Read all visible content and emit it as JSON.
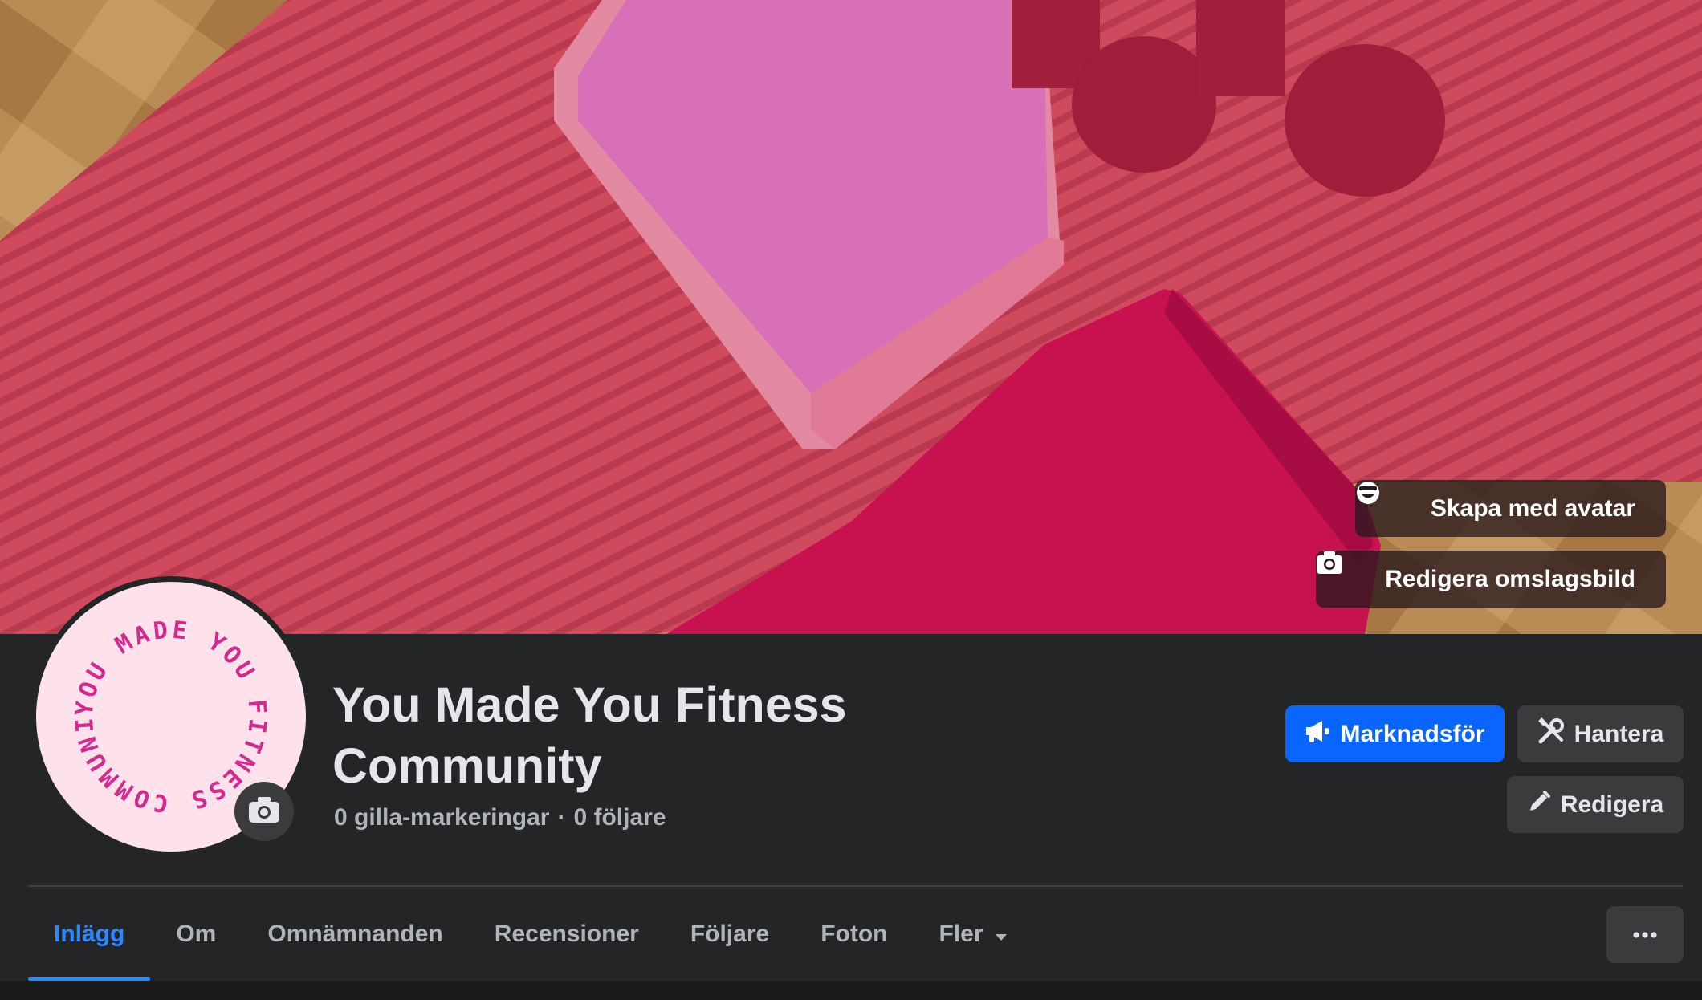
{
  "cover": {
    "avatar_button_label": "Skapa med avatar",
    "edit_cover_label": "Redigera omslagsbild"
  },
  "profile": {
    "logo_text": "YOU MADE YOU FITNESS COMMUNITY",
    "title": "You Made You Fitness Community",
    "likes": "0 gilla-markeringar",
    "separator": "·",
    "followers": "0 följare"
  },
  "actions": {
    "promote_label": "Marknadsför",
    "manage_label": "Hantera",
    "edit_label": "Redigera"
  },
  "tabs": [
    {
      "label": "Inlägg",
      "active": true
    },
    {
      "label": "Om"
    },
    {
      "label": "Omnämnanden"
    },
    {
      "label": "Recensioner"
    },
    {
      "label": "Följare"
    },
    {
      "label": "Foton"
    },
    {
      "label": "Fler",
      "dropdown": true
    }
  ],
  "colors": {
    "accent": "#0866ff",
    "tab_active": "#2d88ff",
    "panel": "#242526",
    "logo_pink": "#d42a8e",
    "logo_bg": "#fde2ec"
  },
  "icons": [
    "avatar-face-icon",
    "camera-icon",
    "megaphone-icon",
    "tools-icon",
    "pencil-icon",
    "caret-down-icon",
    "ellipsis-icon"
  ]
}
